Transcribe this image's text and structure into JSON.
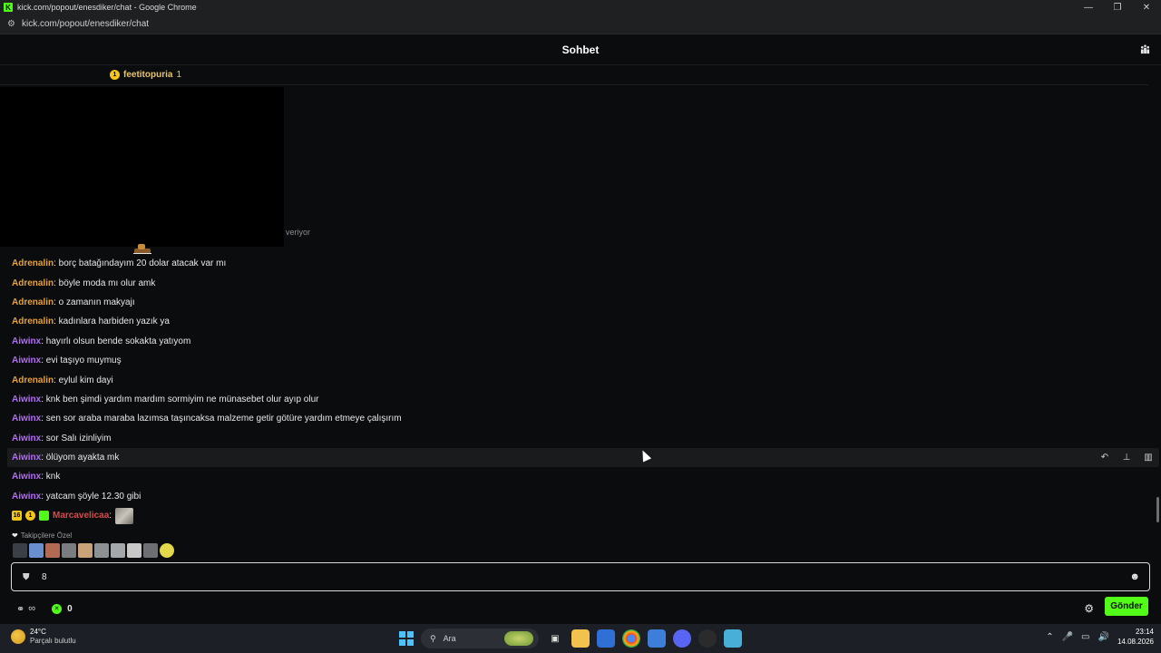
{
  "window": {
    "title": "kick.com/popout/enesdiker/chat - Google Chrome",
    "url": "kick.com/popout/enesdiker/chat",
    "controls": [
      "—",
      "❐",
      "✕"
    ]
  },
  "header": {
    "title": "Sohbet",
    "users_icon": "users-icon"
  },
  "pinned": {
    "username": "feetitopuria",
    "count": "1",
    "badge": "gift-badge"
  },
  "video_overlay_text": "veriyor",
  "messages": [
    {
      "user": "Adrenalin",
      "color": "orange",
      "text": ": borç batağındayım 20 dolar atacak var mı"
    },
    {
      "user": "Adrenalin",
      "color": "orange",
      "text": ": böyle moda mı olur amk"
    },
    {
      "user": "Adrenalin",
      "color": "orange",
      "text": ": o zamanın makyajı"
    },
    {
      "user": "Adrenalin",
      "color": "orange",
      "text": ": kadınlara harbiden yazık ya"
    },
    {
      "user": "Aiwinx",
      "color": "purple",
      "text": ": hayırlı olsun bende sokakta yatıyom"
    },
    {
      "user": "Aiwinx",
      "color": "purple",
      "text": ": evi taşıyo muymuş"
    },
    {
      "user": "Adrenalin",
      "color": "orange",
      "text": ": eylul kim dayi"
    },
    {
      "user": "Aiwinx",
      "color": "purple",
      "text": ": knk ben şimdi yardım mardım sormiyim ne münasebet olur ayıp olur"
    },
    {
      "user": "Aiwinx",
      "color": "purple",
      "text": ": sen sor araba maraba lazımsa taşıncaksa malzeme getir götüre yardım etmeye çalışırım"
    },
    {
      "user": "Aiwinx",
      "color": "purple",
      "text": ": sor Salı izinliyim"
    },
    {
      "user": "Aiwinx",
      "color": "purple",
      "text": ": ölüyom ayakta mk",
      "hover": true
    },
    {
      "user": "Aiwinx",
      "color": "purple",
      "text": ": knk"
    },
    {
      "user": "Aiwinx",
      "color": "purple",
      "text": ": yatcam şöyle 12.30 gibi"
    }
  ],
  "last_message": {
    "badges": [
      "16",
      "1"
    ],
    "user": "Marcavelicaa",
    "text": ":"
  },
  "msg_actions": {
    "reply": "↶",
    "pin": "📌",
    "delete": "🗑"
  },
  "followers_only": {
    "label": "Takipçilere Özel",
    "icon": "heart-icon"
  },
  "emotes": [
    "#3a3f46",
    "#6a8fcf",
    "#b36a52",
    "#7a7d80",
    "#caa27a",
    "#8e9194",
    "#a5a8ab",
    "#c8c8c8",
    "#6e6f72",
    "#e3d94a"
  ],
  "input": {
    "value": "8",
    "shield_icon": "shield-icon",
    "emoji_icon": "emoji-icon"
  },
  "bottom": {
    "points": "0",
    "send_label": "Gönder"
  },
  "taskbar": {
    "temperature": "24°C",
    "weather_desc": "Parçalı bulutlu",
    "search_placeholder": "Ara",
    "time": "23:14",
    "date": "14.08.2026"
  }
}
